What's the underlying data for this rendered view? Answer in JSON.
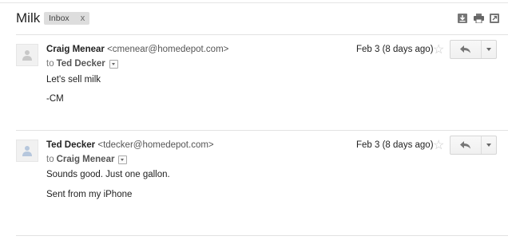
{
  "thread": {
    "subject": "Milk",
    "label": "Inbox",
    "label_remove": "x"
  },
  "toolbar": {
    "icons": [
      "download-icon",
      "print-icon",
      "new-window-icon"
    ]
  },
  "messages": [
    {
      "sender_name": "Craig Menear",
      "sender_email": "<cmenear@homedepot.com>",
      "to_prefix": "to",
      "to_name": "Ted Decker",
      "date": "Feb 3 (8 days ago)",
      "body": [
        "Let's sell milk",
        "-CM"
      ]
    },
    {
      "sender_name": "Ted Decker",
      "sender_email": "<tdecker@homedepot.com>",
      "to_prefix": "to",
      "to_name": "Craig Menear",
      "date": "Feb 3 (8 days ago)",
      "body": [
        "Sounds good. Just one gallon.",
        "Sent from my iPhone"
      ]
    }
  ],
  "colors": {
    "divider": "#e2e2e2",
    "chip_bg": "#dddddd",
    "star": "#c8c8c8"
  }
}
